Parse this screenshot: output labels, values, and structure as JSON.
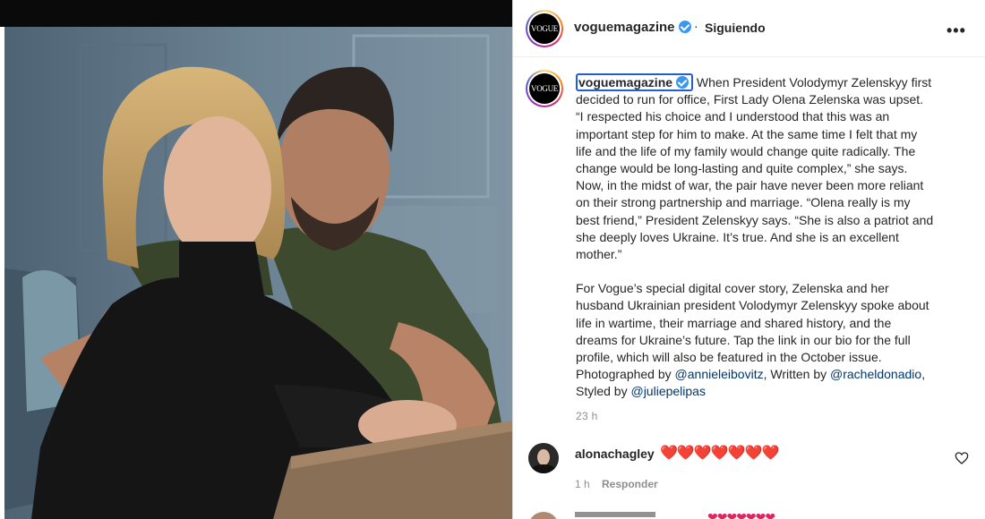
{
  "post": {
    "username": "voguemagazine",
    "avatar_text": "VOGUE",
    "separator": "·",
    "follow_status": "Siguiendo",
    "more_icon": "more-horizontal-icon",
    "verified_icon": "verified-badge-icon",
    "caption_p1": "When President Volodymyr Zelenskyy first decided to run for office, First Lady Olena Zelenska was upset. “I respected his choice and I understood that this was an important step for him to make. At the same time I felt that my life and the life of my family would change quite radically. The change would be long-lasting and quite complex,” she says. Now, in the midst of war, the pair have never been more reliant on their strong partnership and marriage. “Olena really is my best friend,” President Zelenskyy says. “She is also a patriot and she deeply loves Ukraine. It’s true. And she is an excellent mother.”",
    "caption_p2_pre": "For Vogue’s special digital cover story, Zelenska and her husband Ukrainian president Volodymyr Zelenskyy spoke about life in wartime, their marriage and shared history, and the dreams for Ukraine’s future. Tap the link in our bio for the full profile, which will also be featured in the October issue. Photographed by ",
    "mention_1": "@annieleibovitz",
    "sep_1": ", Written by ",
    "mention_2": "@racheldonadio",
    "sep_2": ", Styled by ",
    "mention_3": "@juliepelipas",
    "time": "23 h"
  },
  "comment": {
    "username": "alonachagley",
    "text": "❤️❤️❤️❤️❤️❤️❤️",
    "time": "1 h",
    "reply_label": "Responder",
    "like_icon": "heart-outline-icon"
  },
  "colors": {
    "text": "#262626",
    "secondary": "#8e8e8e",
    "mention": "#00376b",
    "verified": "#3897f0",
    "highlight_border": "#1f5fd1"
  }
}
